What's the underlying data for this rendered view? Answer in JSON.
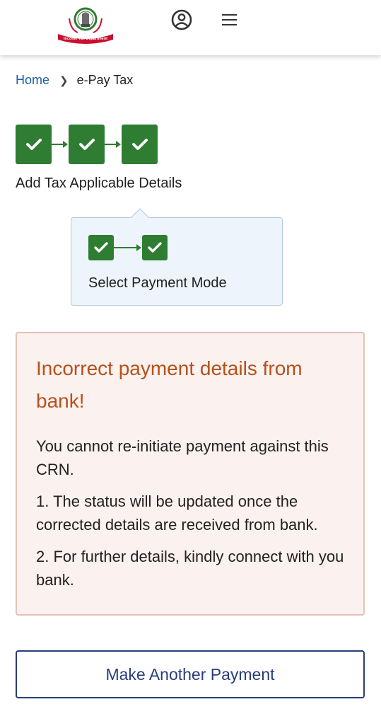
{
  "header": {
    "logo_alt": "Income Tax Department",
    "profile_icon": "user-circle-icon",
    "menu_icon": "hamburger-menu-icon"
  },
  "breadcrumb": {
    "home": "Home",
    "separator_icon": "chevron-right-icon",
    "current": "e-Pay Tax"
  },
  "stepper": {
    "main_step_count_completed": 3,
    "main_step_label": "Add Tax Applicable Details",
    "sub_step_count_completed": 2,
    "sub_step_label": "Select Payment Mode",
    "check_icon": "checkmark-icon",
    "complete_color": "#2e7d32"
  },
  "alert": {
    "title": "Incorrect payment details from bank!",
    "message": "You cannot re-initiate payment against this CRN.",
    "points": [
      "1. The status will be updated once the corrected details are received from bank.",
      "2. For further details, kindly connect with you bank."
    ],
    "title_color": "#b5511c",
    "background": "#fbf1ee"
  },
  "actions": {
    "make_another_payment": "Make Another Payment"
  }
}
